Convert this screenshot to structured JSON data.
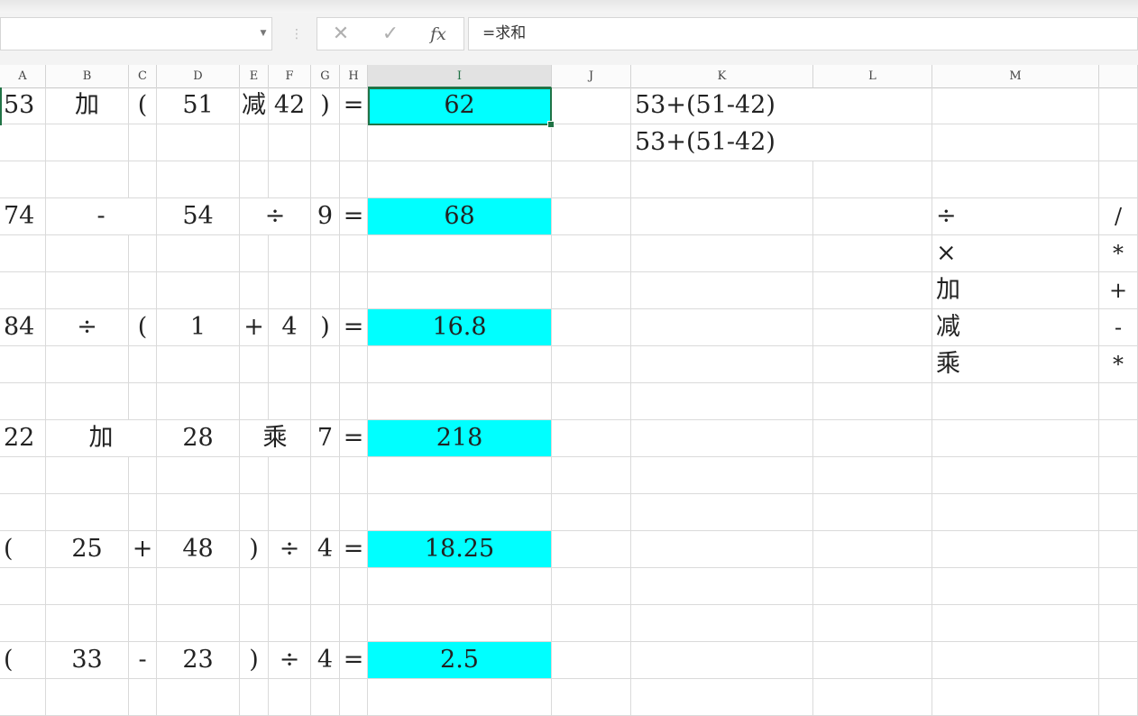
{
  "formula_bar": {
    "name_box": "",
    "cancel_icon": "x-icon",
    "confirm_icon": "check-icon",
    "fx_label": "fx",
    "formula": "=求和"
  },
  "columns": [
    "A",
    "B",
    "C",
    "D",
    "E",
    "F",
    "G",
    "H",
    "I",
    "J",
    "K",
    "L",
    "M"
  ],
  "selected_column": "I",
  "selected_cell": "I1",
  "colors": {
    "highlight": "#00ffff",
    "selection": "#217346"
  },
  "rows": [
    {
      "A": "53",
      "B": "加",
      "C": "(",
      "D": "51",
      "E": "减",
      "F": "42",
      "G": ")",
      "H": "=",
      "I": "62",
      "K": "53+(51-42)"
    },
    {
      "K": "53+(51-42)"
    },
    {},
    {
      "A": "74",
      "BC": "-",
      "D": "54",
      "EF": "÷",
      "G": "9",
      "H": "=",
      "I": "68",
      "M": "÷",
      "N": "/"
    },
    {
      "M": "×",
      "N": "*"
    },
    {
      "M": "加",
      "N": "+"
    },
    {
      "A": "84",
      "B": "÷",
      "C": "(",
      "D": "1",
      "E": "+",
      "F": "4",
      "G": ")",
      "H": "=",
      "I": "16.8",
      "M": "减",
      "N": "-"
    },
    {
      "M": "乘",
      "N": "*"
    },
    {},
    {
      "A": "22",
      "BC": "加",
      "D": "28",
      "EF": "乘",
      "G": "7",
      "H": "=",
      "I": "218"
    },
    {},
    {},
    {
      "A": "(",
      "B": "25",
      "C": "+",
      "D": "48",
      "E": ")",
      "F": "÷",
      "G": "4",
      "H": "=",
      "I": "18.25"
    },
    {},
    {},
    {
      "A": "(",
      "B": "33",
      "C": "-",
      "D": "23",
      "E": ")",
      "F": "÷",
      "G": "4",
      "H": "=",
      "I": "2.5"
    },
    {}
  ]
}
